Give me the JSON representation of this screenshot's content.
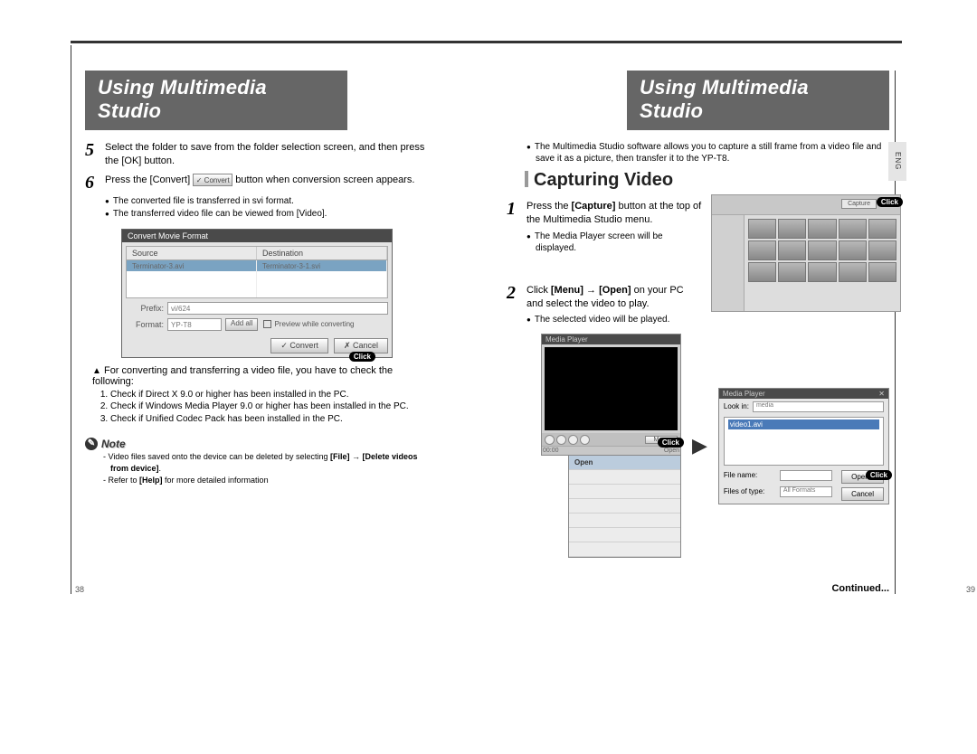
{
  "left_title": "Using Multimedia Studio",
  "right_title": "Using Multimedia Studio",
  "side_tab": "ENG",
  "left_page_num": "38",
  "right_page_num": "39",
  "continued": "Continued...",
  "step5": {
    "num": "5",
    "text": "Select the folder to save from the folder selection screen, and then press the [OK] button."
  },
  "step6": {
    "num": "6",
    "text_a": "Press the [Convert]",
    "text_b": "button when conversion screen appears.",
    "btn_label": "✓ Convert"
  },
  "step6_bullets": [
    "The converted file is transferred in svi format.",
    "The transferred video file can be viewed from [Video]."
  ],
  "dialog": {
    "title": "Convert Movie Format",
    "col_source": "Source",
    "col_dest": "Destination",
    "row_src": "Terminator-3.avi",
    "row_dst": "Terminator-3-1.svi",
    "prefix_lbl": "Prefix:",
    "prefix_val": "vi/624",
    "format_lbl": "Format:",
    "format_val": "YP-T8",
    "add_btn": "Add all",
    "preview_chk": "Preview while converting",
    "convert_btn": "✓ Convert",
    "cancel_btn": "✗ Cancel",
    "click": "Click"
  },
  "check_intro": "For converting and transferring a video file, you have to check the following:",
  "check_items": [
    "Check if Direct X 9.0 or higher has been installed in the PC.",
    "Check if Windows Media Player 9.0 or higher has been installed in the PC.",
    "Check if Unified Codec Pack has been installed in the PC."
  ],
  "note_title": "Note",
  "note_lines_a": {
    "pre": "Video files saved onto the device can be deleted by selecting ",
    "b1": "[File]",
    "mid": " → ",
    "b2": "[Delete videos from device]",
    "post": "."
  },
  "note_line_b": {
    "pre": "Refer to ",
    "b": "[Help]",
    "post": " for more detailed information"
  },
  "right_intro": "The Multimedia Studio software allows you to capture a still frame from a video file and save it as a picture, then transfer it to the YP-T8.",
  "section_heading": "Capturing Video",
  "rstep1": {
    "num": "1",
    "text_a": "Press the ",
    "b": "[Capture]",
    "text_b": " button at the top of the Multimedia Studio menu."
  },
  "rstep1_bullet": "The Media Player screen will be displayed.",
  "rstep2": {
    "num": "2",
    "text_a": "Click ",
    "b1": "[Menu]",
    "arrow": " → ",
    "b2": "[Open]",
    "text_b": " on your PC and select the video to play."
  },
  "rstep2_bullet": "The selected video will be played.",
  "thumb_capture_label": "Capture",
  "thumb_click": "Click",
  "player": {
    "title": "Media Player",
    "menu": "Menu",
    "open": "Open",
    "click": "Click"
  },
  "open_dlg": {
    "title": "Media Player",
    "lookin_lbl": "Look in:",
    "lookin_val": "media",
    "file_item": "video1.avi",
    "name_lbl": "File name:",
    "type_lbl": "Files of type:",
    "type_val": "All Formats",
    "open_btn": "Open",
    "cancel_btn": "Cancel",
    "click": "Click"
  }
}
